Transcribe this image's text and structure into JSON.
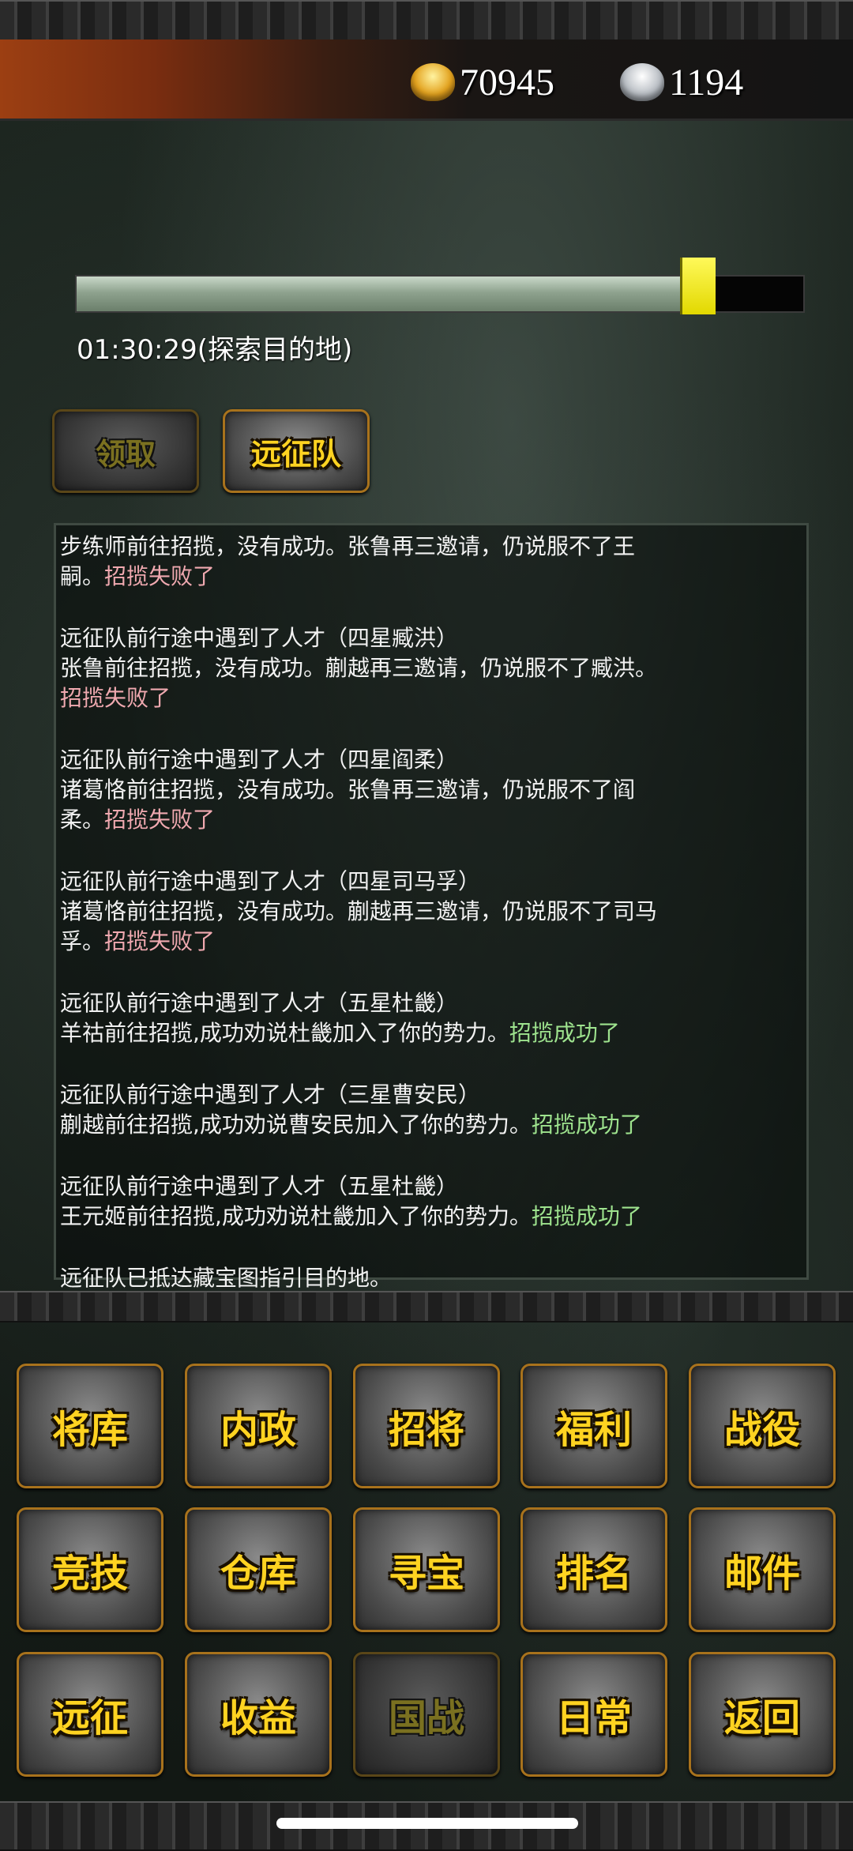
{
  "resources": {
    "gold": "70945",
    "silver": "1194"
  },
  "expedition": {
    "progress": 0.87,
    "timer_text": "01:30:29(探索目的地)",
    "claim_button": "领取",
    "team_button": "远征队"
  },
  "log": [
    {
      "lines": [
        {
          "text": "步练师前往招揽，没有成功。张鲁再三邀请，仍说服不了王嗣。",
          "result": "招揽失败了",
          "status": "fail"
        }
      ]
    },
    {
      "lines": [
        {
          "text": "远征队前行途中遇到了人才（四星臧洪）"
        },
        {
          "text": "张鲁前往招揽，没有成功。蒯越再三邀请，仍说服不了臧洪。",
          "result": "招揽失败了",
          "status": "fail"
        }
      ]
    },
    {
      "lines": [
        {
          "text": "远征队前行途中遇到了人才（四星阎柔）"
        },
        {
          "text": "诸葛恪前往招揽，没有成功。张鲁再三邀请，仍说服不了阎柔。",
          "result": "招揽失败了",
          "status": "fail"
        }
      ]
    },
    {
      "lines": [
        {
          "text": "远征队前行途中遇到了人才（四星司马孚）"
        },
        {
          "text": "诸葛恪前往招揽，没有成功。蒯越再三邀请，仍说服不了司马孚。",
          "result": "招揽失败了",
          "status": "fail"
        }
      ]
    },
    {
      "lines": [
        {
          "text": "远征队前行途中遇到了人才（五星杜畿）"
        },
        {
          "text": "羊祜前往招揽,成功劝说杜畿加入了你的势力。",
          "result": "招揽成功了",
          "status": "success"
        }
      ]
    },
    {
      "lines": [
        {
          "text": "远征队前行途中遇到了人才（三星曹安民）"
        },
        {
          "text": "蒯越前往招揽,成功劝说曹安民加入了你的势力。",
          "result": "招揽成功了",
          "status": "success"
        }
      ]
    },
    {
      "lines": [
        {
          "text": "远征队前行途中遇到了人才（五星杜畿）"
        },
        {
          "text": "王元姬前往招揽,成功劝说杜畿加入了你的势力。",
          "result": "招揽成功了",
          "status": "success"
        }
      ]
    },
    {
      "lines": [
        {
          "text": "远征队已抵达藏宝图指引目的地。"
        }
      ]
    }
  ],
  "menu": [
    {
      "label": "将库",
      "enabled": true
    },
    {
      "label": "内政",
      "enabled": true
    },
    {
      "label": "招将",
      "enabled": true
    },
    {
      "label": "福利",
      "enabled": true
    },
    {
      "label": "战役",
      "enabled": true
    },
    {
      "label": "竞技",
      "enabled": true
    },
    {
      "label": "仓库",
      "enabled": true
    },
    {
      "label": "寻宝",
      "enabled": true
    },
    {
      "label": "排名",
      "enabled": true
    },
    {
      "label": "邮件",
      "enabled": true
    },
    {
      "label": "远征",
      "enabled": true
    },
    {
      "label": "收益",
      "enabled": true
    },
    {
      "label": "国战",
      "enabled": false
    },
    {
      "label": "日常",
      "enabled": true
    },
    {
      "label": "返回",
      "enabled": true
    }
  ]
}
